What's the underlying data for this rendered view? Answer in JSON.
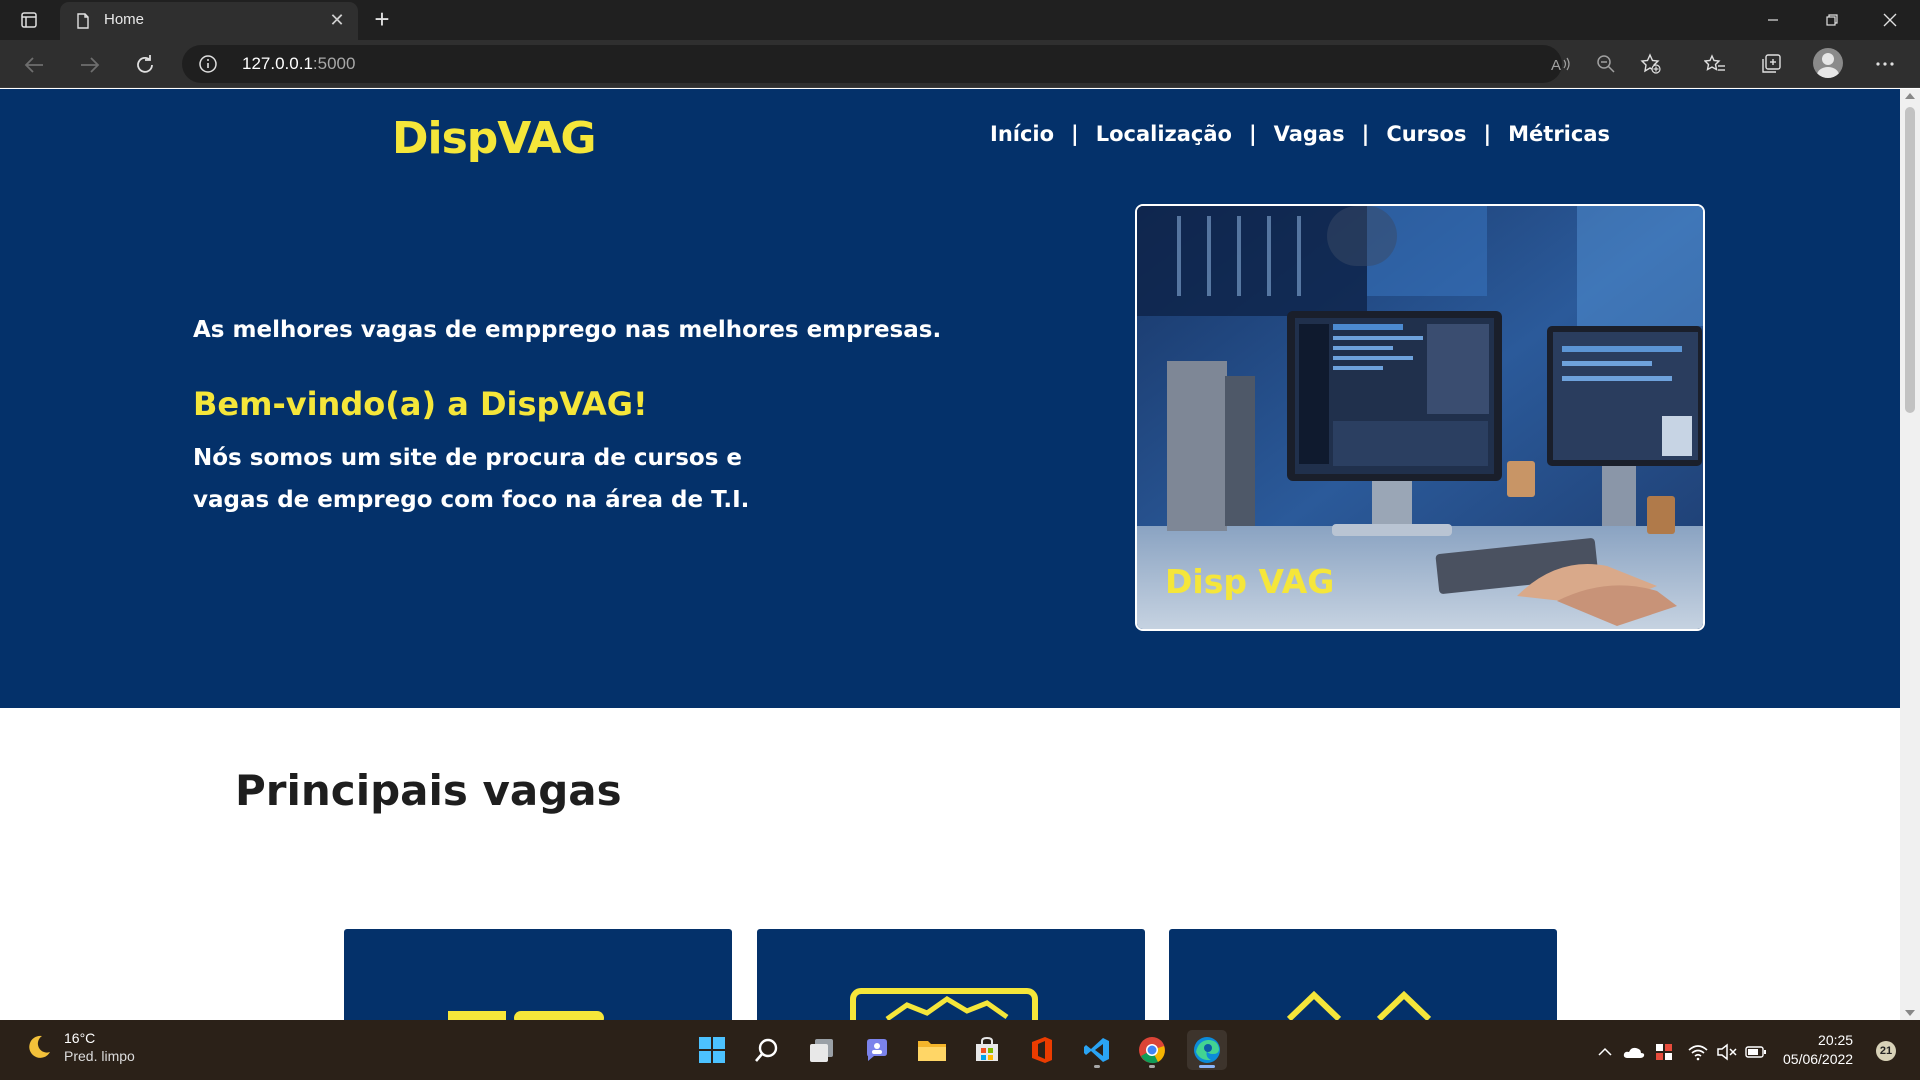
{
  "browser": {
    "tab_title": "Home",
    "url_host": "127.0.0.1",
    "url_port": ":5000"
  },
  "site": {
    "logo": "DispVAG",
    "nav": [
      "Início",
      "Localização",
      "Vagas",
      "Cursos",
      "Métricas"
    ],
    "nav_separator": "|",
    "hero_tagline": "As melhores vagas de empprego nas melhores empresas.",
    "hero_welcome": "Bem-vindo(a) a DispVAG!",
    "hero_description_line1": "Nós somos um site de procura de cursos e",
    "hero_description_line2": "vagas de emprego com foco na área de T.I.",
    "hero_image_logo": "Disp VAG",
    "section_title": "Principais vagas"
  },
  "colors": {
    "brand_blue": "#04316a",
    "brand_yellow": "#f5e63a"
  },
  "taskbar": {
    "weather_temp": "16°C",
    "weather_desc": "Pred. limpo",
    "time": "20:25",
    "date": "05/06/2022",
    "notification_count": "21",
    "apps": [
      "start-icon",
      "search-icon",
      "task-view-icon",
      "chat-icon",
      "file-explorer-icon",
      "store-icon",
      "office-icon",
      "vscode-icon",
      "chrome-icon",
      "edge-icon"
    ]
  }
}
